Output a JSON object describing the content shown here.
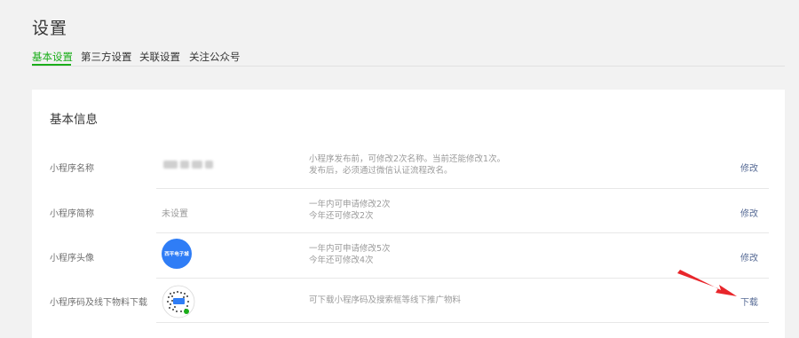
{
  "page": {
    "title": "设置"
  },
  "tabs": [
    {
      "label": "基本设置",
      "active": true
    },
    {
      "label": "第三方设置",
      "active": false
    },
    {
      "label": "关联设置",
      "active": false
    },
    {
      "label": "关注公众号",
      "active": false
    }
  ],
  "card": {
    "title": "基本信息",
    "rows": [
      {
        "label": "小程序名称",
        "value": "",
        "desc": [
          "小程序发布前，可修改2次名称。当前还能修改1次。",
          "发布后，必须通过微信认证流程改名。"
        ],
        "action": "修改"
      },
      {
        "label": "小程序简称",
        "value": "未设置",
        "desc": [
          "一年内可申请修改2次",
          "今年还可修改2次"
        ],
        "action": "修改"
      },
      {
        "label": "小程序头像",
        "value": "",
        "avatar_text": "西平电子城",
        "desc": [
          "一年内可申请修改5次",
          "今年还可修改4次"
        ],
        "action": "修改"
      },
      {
        "label": "小程序码及线下物料下载",
        "value": "",
        "desc": [
          "可下载小程序码及搜索框等线下推广物料"
        ],
        "action": "下载"
      }
    ]
  },
  "colors": {
    "accent_green": "#1aad19",
    "link_blue": "#576b95",
    "annotation_red": "#e8262b",
    "avatar_blue": "#2f7df6"
  },
  "icons": {
    "annotation": "red-arrow-icon",
    "qrcode": "mini-program-code-icon"
  }
}
